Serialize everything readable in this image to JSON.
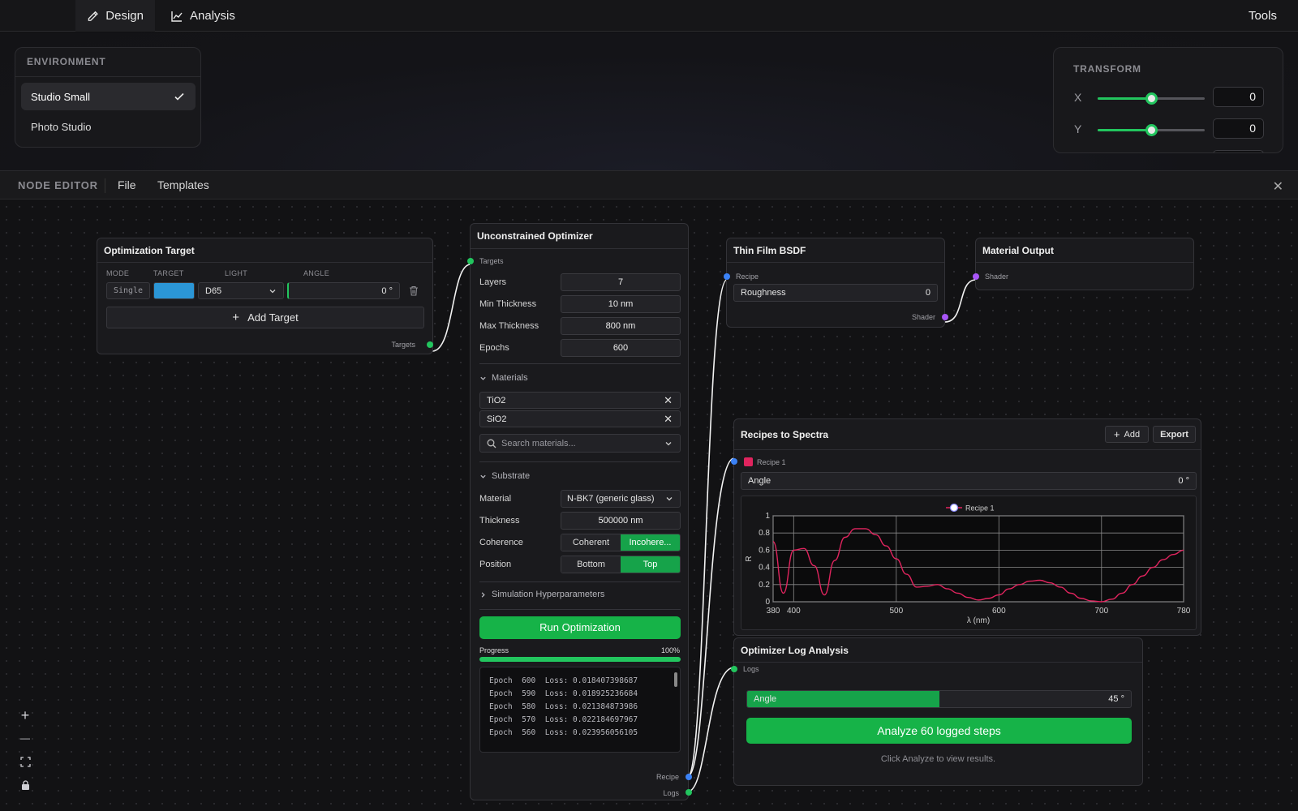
{
  "topbar": {
    "tabs": [
      {
        "label": "Design",
        "icon": "pencil-icon"
      },
      {
        "label": "Analysis",
        "icon": "chart-line-icon"
      }
    ],
    "tools_label": "Tools"
  },
  "environment": {
    "title": "ENVIRONMENT",
    "items": [
      {
        "label": "Studio Small",
        "selected": true
      },
      {
        "label": "Photo Studio",
        "selected": false
      }
    ]
  },
  "transform": {
    "title": "TRANSFORM",
    "x_label": "X",
    "x_value": "0",
    "x_slider": 0.5,
    "y_label": "Y",
    "y_value": "0",
    "y_slider": 0.5
  },
  "node_editor": {
    "title": "NODE EDITOR",
    "menu": [
      "File",
      "Templates"
    ],
    "close": "✕"
  },
  "optimization_target": {
    "title": "Optimization Target",
    "col_mode": "MODE",
    "col_target": "TARGET",
    "col_light": "LIGHT",
    "col_angle": "ANGLE",
    "mode": "Single",
    "target_color": "#2b96d6",
    "light": "D65",
    "angle": "0 °",
    "add_target": "Add Target",
    "port_out": "Targets"
  },
  "optimizer": {
    "title": "Unconstrained Optimizer",
    "port_in": "Targets",
    "params": [
      {
        "label": "Layers",
        "value": "7"
      },
      {
        "label": "Min Thickness",
        "value": "10 nm"
      },
      {
        "label": "Max Thickness",
        "value": "800 nm"
      },
      {
        "label": "Epochs",
        "value": "600"
      }
    ],
    "materials_header": "Materials",
    "materials": [
      "TiO2",
      "SiO2"
    ],
    "search_placeholder": "Search materials...",
    "substrate_header": "Substrate",
    "substrate": {
      "material_label": "Material",
      "material_value": "N-BK7 (generic glass)",
      "thickness_label": "Thickness",
      "thickness_value": "500000 nm",
      "coherence_label": "Coherence",
      "coherence_options": [
        "Coherent",
        "Incohere..."
      ],
      "coherence_selected": 1,
      "position_label": "Position",
      "position_options": [
        "Bottom",
        "Top"
      ],
      "position_selected": 1
    },
    "sim_header": "Simulation Hyperparameters",
    "run_label": "Run Optimization",
    "progress_label": "Progress",
    "progress_text": "100%",
    "progress": 1.0,
    "log": [
      {
        "epoch": "600",
        "loss": "0.018407398687"
      },
      {
        "epoch": "590",
        "loss": "0.018925236684"
      },
      {
        "epoch": "580",
        "loss": "0.021384873986"
      },
      {
        "epoch": "570",
        "loss": "0.022184697967"
      },
      {
        "epoch": "560",
        "loss": "0.023956056105"
      }
    ],
    "log_epoch_word": "Epoch",
    "log_loss_word": "Loss:",
    "port_recipe": "Recipe",
    "port_logs": "Logs"
  },
  "thin_film": {
    "title": "Thin Film BSDF",
    "port_in": "Recipe",
    "roughness_label": "Roughness",
    "roughness_value": "0",
    "port_out": "Shader"
  },
  "material_output": {
    "title": "Material Output",
    "port_in": "Shader"
  },
  "spectra": {
    "title": "Recipes to Spectra",
    "add_label": "Add",
    "export_label": "Export",
    "recipe_label": "Recipe 1",
    "recipe_color": "#e0245e",
    "angle_label": "Angle",
    "angle_value": "0 °"
  },
  "chart_data": {
    "type": "line",
    "series": [
      {
        "name": "Recipe 1",
        "color": "#e0245e",
        "x": [
          380,
          390,
          400,
          410,
          420,
          430,
          440,
          450,
          460,
          470,
          480,
          490,
          500,
          510,
          520,
          530,
          540,
          550,
          560,
          570,
          580,
          590,
          600,
          610,
          620,
          630,
          640,
          650,
          660,
          670,
          680,
          690,
          700,
          710,
          720,
          730,
          740,
          750,
          760,
          770,
          780
        ],
        "values": [
          0.7,
          0.1,
          0.6,
          0.62,
          0.42,
          0.08,
          0.48,
          0.75,
          0.85,
          0.85,
          0.78,
          0.65,
          0.5,
          0.32,
          0.17,
          0.18,
          0.2,
          0.15,
          0.1,
          0.05,
          0.02,
          0.04,
          0.08,
          0.15,
          0.2,
          0.24,
          0.25,
          0.22,
          0.17,
          0.1,
          0.04,
          0.01,
          0.0,
          0.03,
          0.1,
          0.2,
          0.3,
          0.4,
          0.49,
          0.55,
          0.6
        ]
      }
    ],
    "xlabel": "λ (nm)",
    "ylabel": "R",
    "xlim": [
      380,
      780
    ],
    "ylim": [
      0,
      1
    ],
    "xticks": [
      380,
      400,
      500,
      600,
      700,
      780
    ],
    "yticks": [
      0,
      0.2,
      0.4,
      0.6,
      0.8,
      1
    ],
    "grid": true,
    "legend": "top-center"
  },
  "log_analysis": {
    "title": "Optimizer Log Analysis",
    "port_in": "Logs",
    "angle_label": "Angle",
    "angle_value": "45 °",
    "angle_fraction": 0.5,
    "analyze_label": "Analyze 60 logged steps",
    "hint": "Click Analyze to view results."
  },
  "zoom_controls": [
    "+",
    "—",
    "⛶",
    "🔒"
  ]
}
